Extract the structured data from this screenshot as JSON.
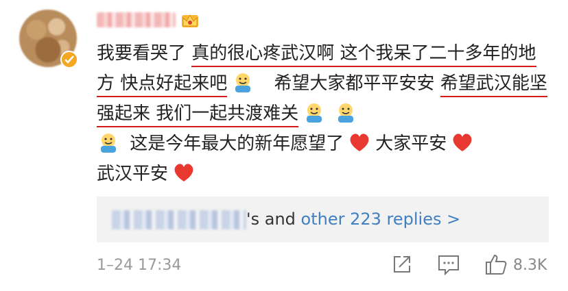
{
  "comment": {
    "user": {
      "name_blurred": true,
      "badge_icon": "crown-icon",
      "verified_icon": "verified-icon"
    },
    "lines": [
      "我要看哭了 ",
      "真的很心疼武汉啊 这个我呆了二十多年的地方 快点好起来吧",
      "希望大家都平平安安",
      "希望武汉能坚强起来 我们一起共渡难关",
      "这是今年最大的新年愿望了",
      "大家平安",
      "武汉平安"
    ],
    "underline_color": "#d41919"
  },
  "replies": {
    "suffix": "'s and ",
    "link_text": "other 223 replies >"
  },
  "footer": {
    "time": "1–24 17:34",
    "likes": "8.3K"
  }
}
